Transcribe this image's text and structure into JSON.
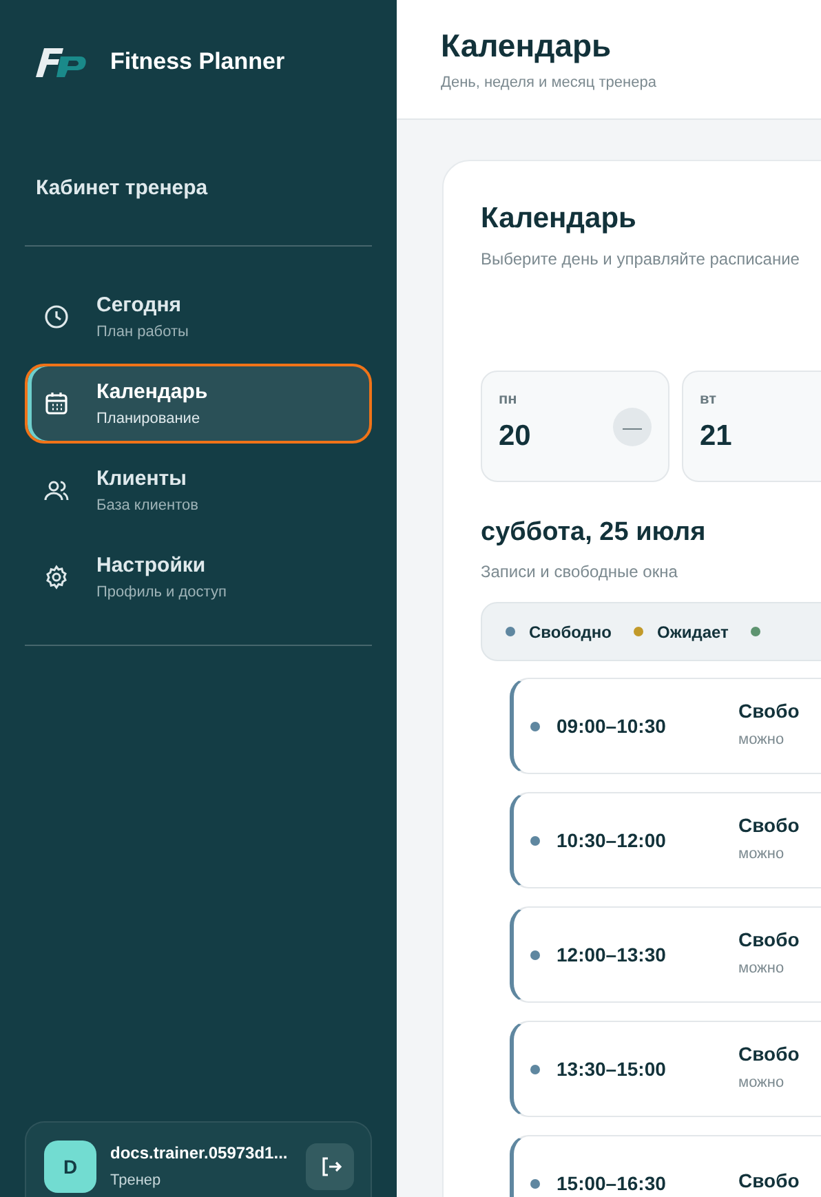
{
  "brand": {
    "title": "Fitness Planner"
  },
  "sidebar": {
    "heading": "Кабинет тренера",
    "items": [
      {
        "label": "Сегодня",
        "sublabel": "План работы",
        "selected": false
      },
      {
        "label": "Календарь",
        "sublabel": "Планирование",
        "selected": true
      },
      {
        "label": "Клиенты",
        "sublabel": "База клиентов",
        "selected": false
      },
      {
        "label": "Настройки",
        "sublabel": "Профиль и доступ",
        "selected": false
      }
    ],
    "user": {
      "initial": "D",
      "name": "docs.trainer.05973d1...",
      "role": "Тренер"
    }
  },
  "header": {
    "title": "Календарь",
    "subtitle": "День, неделя и месяц тренера"
  },
  "calendar": {
    "title": "Календарь",
    "subtitle": "Выберите день и управляйте расписание",
    "days": [
      {
        "weekday": "пн",
        "date": "20",
        "indicator": "—"
      },
      {
        "weekday": "вт",
        "date": "21"
      }
    ],
    "day_title": "суббота, 25 июля",
    "day_subtitle": "Записи и свободные окна",
    "legend": [
      {
        "label": "Свободно",
        "color": "#5f87a0"
      },
      {
        "label": "Ожидает",
        "color": "#c29a2a"
      },
      {
        "color": "#5e9470"
      }
    ],
    "slots": [
      {
        "time": "09:00–10:30",
        "status": "Свобо",
        "note": "можно",
        "color": "#5f87a0"
      },
      {
        "time": "10:30–12:00",
        "status": "Свобо",
        "note": "можно",
        "color": "#5f87a0"
      },
      {
        "time": "12:00–13:30",
        "status": "Свобо",
        "note": "можно",
        "color": "#5f87a0"
      },
      {
        "time": "13:30–15:00",
        "status": "Свобо",
        "note": "можно",
        "color": "#5f87a0"
      },
      {
        "time": "15:00–16:30",
        "status": "Свобо",
        "color": "#5f87a0"
      }
    ]
  }
}
